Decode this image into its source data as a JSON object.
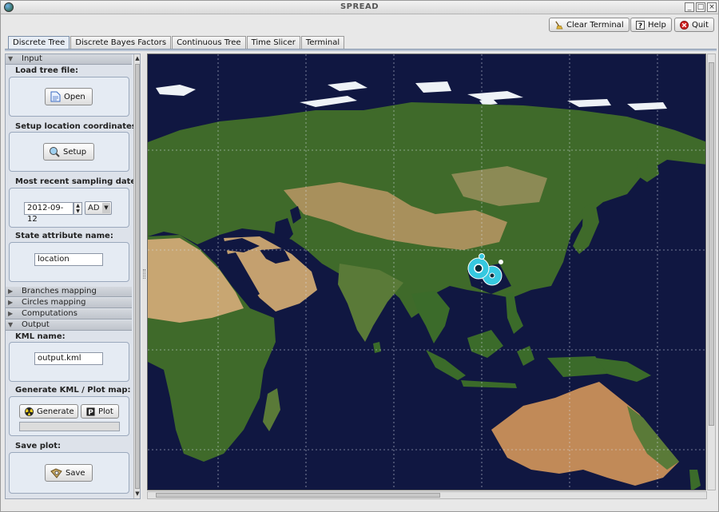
{
  "window": {
    "title": "SPREAD",
    "minimize": "_",
    "maximize": "□",
    "close": "×"
  },
  "toolbar": {
    "clear_terminal": "Clear Terminal",
    "help": "Help",
    "quit": "Quit"
  },
  "tabs": [
    "Discrete Tree",
    "Discrete Bayes Factors",
    "Continuous Tree",
    "Time Slicer",
    "Terminal"
  ],
  "sections": {
    "input": "Input",
    "branches_mapping": "Branches mapping",
    "circles_mapping": "Circles mapping",
    "computations": "Computations",
    "output": "Output"
  },
  "input": {
    "load_tree_label": "Load tree file:",
    "open_button": "Open",
    "setup_label": "Setup location coordinates:",
    "setup_button": "Setup",
    "sampling_date_label": "Most recent sampling date:",
    "sampling_date_value": "2012-09-12",
    "era_value": "AD",
    "state_attribute_label": "State attribute name:",
    "state_attribute_value": "location"
  },
  "output": {
    "kml_name_label": "KML name:",
    "kml_name_value": "output.kml",
    "generate_label": "Generate KML / Plot map:",
    "generate_button": "Generate",
    "plot_button": "Plot",
    "save_plot_label": "Save plot:",
    "save_button": "Save"
  },
  "icons": {
    "app": "globe-icon",
    "clear_terminal": "broom-icon",
    "help": "question-icon",
    "quit": "stop-icon",
    "open": "document-icon",
    "setup": "magnifier-globe-icon",
    "generate": "radiation-icon",
    "plot": "p-letter-icon",
    "save": "save-disk-icon"
  },
  "colors": {
    "ocean": "#101741",
    "land_green": "#3f6a2a",
    "land_desert": "#c4a06f",
    "ice": "#eef2f6",
    "circle_highlight": "#36c8e0"
  }
}
